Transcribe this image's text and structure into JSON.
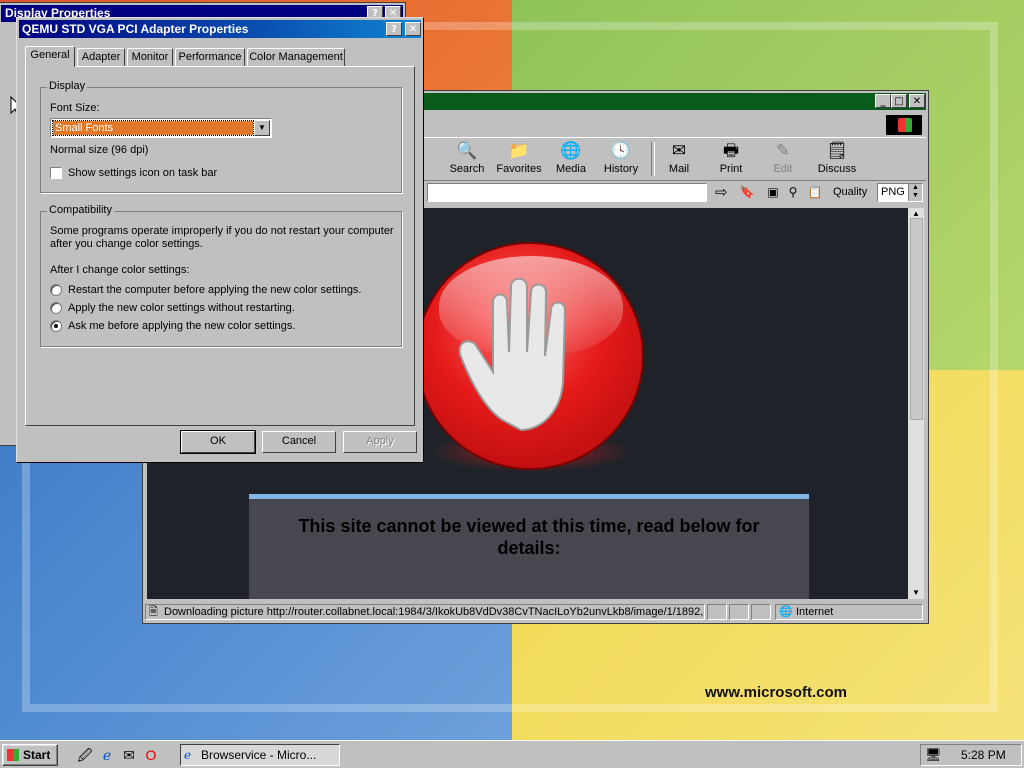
{
  "desktop": {
    "wallpaper_text": "www.microsoft.com"
  },
  "back_window": {
    "title": "Display Properties",
    "help_btn": "?",
    "close_btn": "✕"
  },
  "browser": {
    "min_btn": "_",
    "max_btn": "□",
    "close_btn": "✕",
    "toolbar": [
      {
        "label": "Search",
        "icon": "search-icon"
      },
      {
        "label": "Favorites",
        "icon": "favorites-icon"
      },
      {
        "label": "Media",
        "icon": "media-icon"
      },
      {
        "label": "History",
        "icon": "history-icon"
      },
      {
        "label": "Mail",
        "icon": "mail-icon"
      },
      {
        "label": "Print",
        "icon": "print-icon"
      },
      {
        "label": "Edit",
        "icon": "edit-icon",
        "disabled": true
      },
      {
        "label": "Discuss",
        "icon": "discuss-icon"
      }
    ],
    "quality_label": "Quality",
    "quality_value": "PNG",
    "page_message": "This site cannot be viewed at this time, read below for details:",
    "status_text": "Downloading picture http://router.collabnet.local:1984/3/IkokUb8VdDv38CvTNacILoYb2unvLkb8/image/1/1892,",
    "zone_text": "Internet"
  },
  "dialog": {
    "title": "QEMU STD VGA PCI Adapter Properties",
    "help_btn": "?",
    "close_btn": "✕",
    "tabs": [
      "General",
      "Adapter",
      "Monitor",
      "Performance",
      "Color Management"
    ],
    "active_tab": "General",
    "display_group": {
      "label": "Display",
      "font_size_label": "Font Size:",
      "font_size_value": "Small Fonts",
      "normal_size": "Normal size (96 dpi)",
      "show_icon_label": "Show settings icon on task bar",
      "show_icon_checked": false
    },
    "compat_group": {
      "label": "Compatibility",
      "desc_line1": "Some programs operate improperly if you do not restart your computer",
      "desc_line2": "after you change color settings.",
      "after_label": "After I change color settings:",
      "options": [
        {
          "label": "Restart the computer before applying the new color settings.",
          "selected": false
        },
        {
          "label": "Apply the new color settings without restarting.",
          "selected": false
        },
        {
          "label": "Ask me before applying the new color settings.",
          "selected": true
        }
      ]
    },
    "buttons": {
      "ok": "OK",
      "cancel": "Cancel",
      "apply": "Apply"
    }
  },
  "taskbar": {
    "start_label": "Start",
    "task_label": "Browservice - Micro...",
    "clock": "5:28 PM"
  }
}
